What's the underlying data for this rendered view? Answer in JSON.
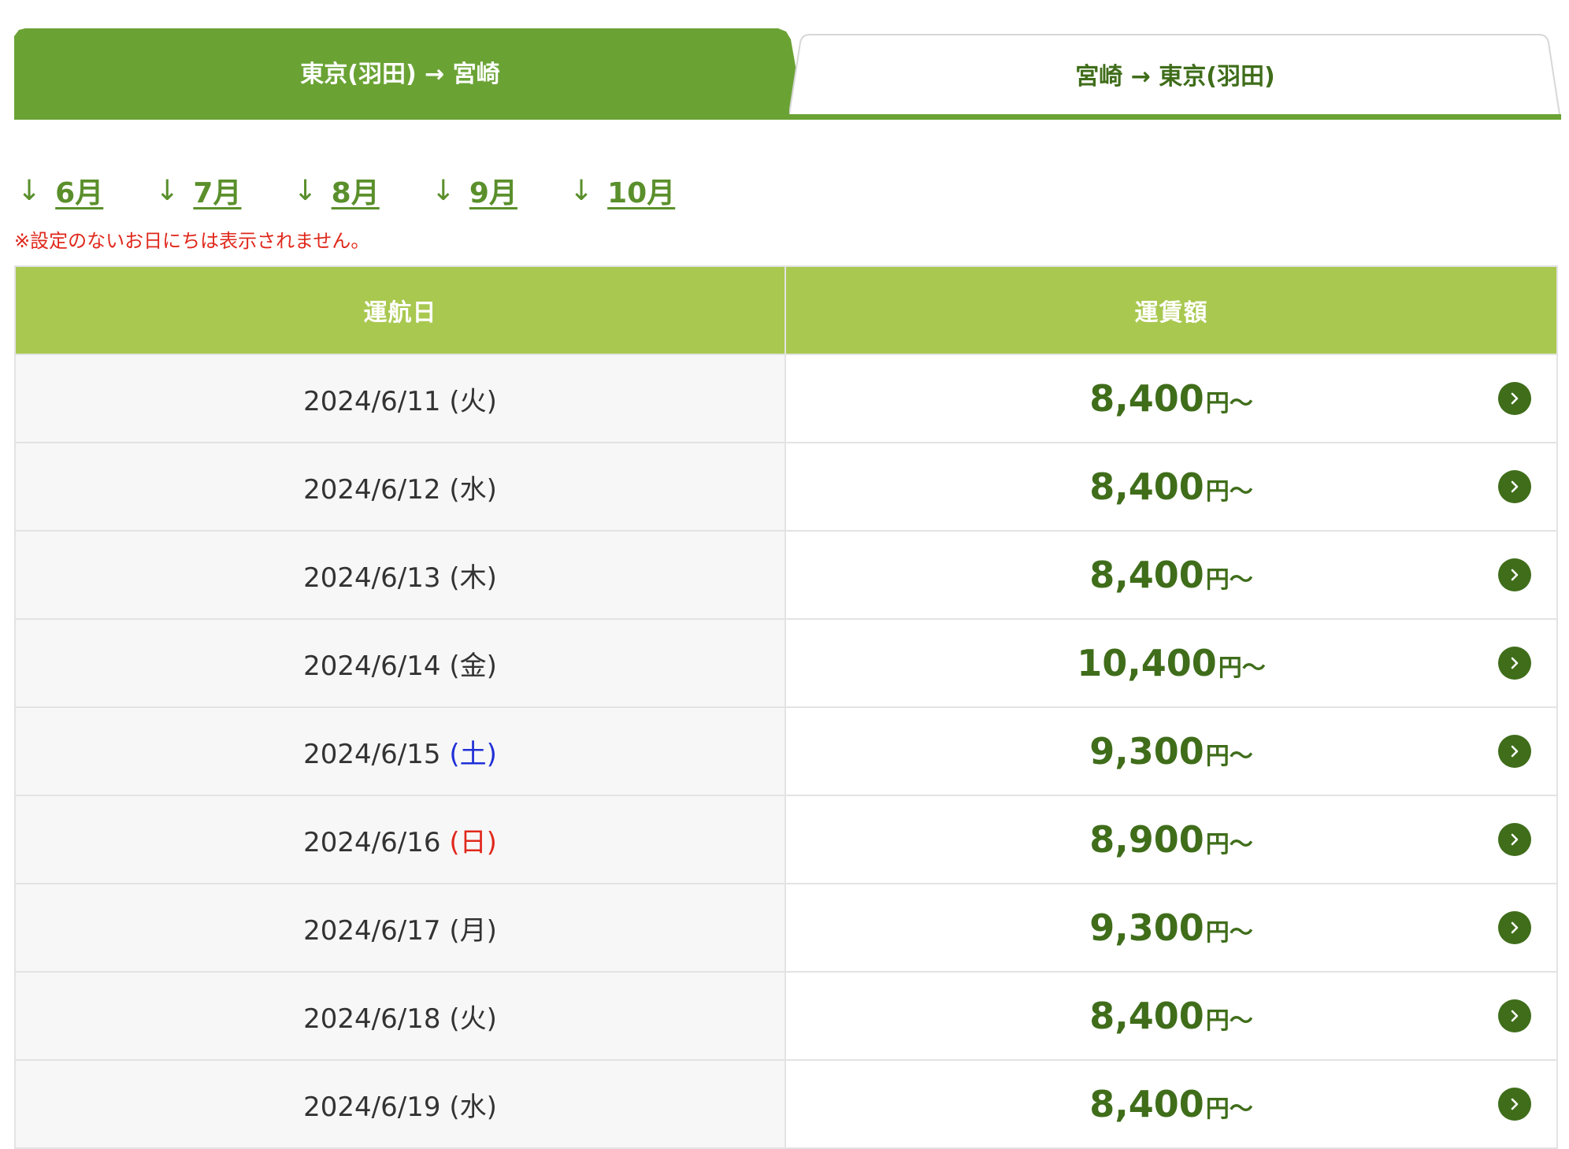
{
  "tabs": {
    "outbound": "東京(羽田) → 宮崎",
    "return": "宮崎 → 東京(羽田)"
  },
  "months": [
    "6月",
    "7月",
    "8月",
    "9月",
    "10月"
  ],
  "month_arrow": "↓",
  "note": "※設定のないお日にちは表示されません。",
  "table": {
    "headers": {
      "date": "運航日",
      "fare": "運賃額"
    },
    "price_suffix": "円〜",
    "rows": [
      {
        "date": "2024/6/11",
        "dow": "(火)",
        "dow_type": "weekday",
        "price": "8,400"
      },
      {
        "date": "2024/6/12",
        "dow": "(水)",
        "dow_type": "weekday",
        "price": "8,400"
      },
      {
        "date": "2024/6/13",
        "dow": "(木)",
        "dow_type": "weekday",
        "price": "8,400"
      },
      {
        "date": "2024/6/14",
        "dow": "(金)",
        "dow_type": "weekday",
        "price": "10,400"
      },
      {
        "date": "2024/6/15",
        "dow": "(土)",
        "dow_type": "saturday",
        "price": "9,300"
      },
      {
        "date": "2024/6/16",
        "dow": "(日)",
        "dow_type": "sunday",
        "price": "8,900"
      },
      {
        "date": "2024/6/17",
        "dow": "(月)",
        "dow_type": "weekday",
        "price": "9,300"
      },
      {
        "date": "2024/6/18",
        "dow": "(火)",
        "dow_type": "weekday",
        "price": "8,400"
      },
      {
        "date": "2024/6/19",
        "dow": "(水)",
        "dow_type": "weekday",
        "price": "8,400"
      }
    ]
  },
  "colors": {
    "primary_green": "#6aa334",
    "header_green": "#a9c850",
    "price_green": "#3f6d1a",
    "note_red": "#e0281c",
    "saturday_blue": "#1f2fd6",
    "sunday_red": "#e0281c"
  },
  "icons": {
    "row_action": "chevron-right-circle-icon"
  }
}
